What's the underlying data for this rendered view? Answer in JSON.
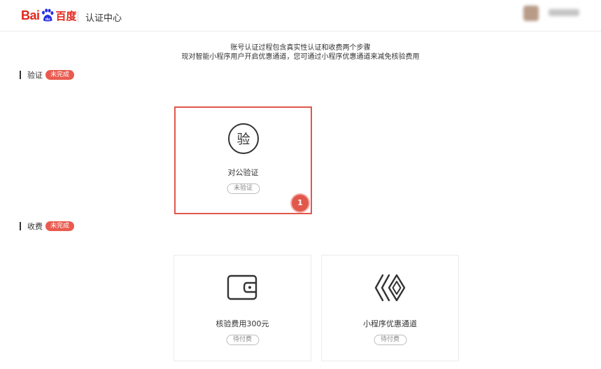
{
  "header": {
    "logo_text": "Bai",
    "logo_cn": "百度",
    "title": "认证中心"
  },
  "notice": {
    "line1": "账号认证过程包含真实性认证和收费两个步骤",
    "line2": "现对智能小程序用户开启优惠通道，您可通过小程序优惠通道来减免核验费用"
  },
  "sections": {
    "verify": {
      "label": "验证",
      "status": "未完成"
    },
    "fee": {
      "label": "收费",
      "status": "未完成"
    }
  },
  "cards": {
    "corporate": {
      "icon_char": "验",
      "title": "对公验证",
      "status": "未验证",
      "step": "1"
    },
    "fee": {
      "title": "核验费用300元",
      "status": "待付费"
    },
    "miniapp": {
      "title": "小程序优惠通道",
      "status": "待付费"
    }
  },
  "colors": {
    "brand": "#e1251b",
    "accent": "#e2574c",
    "badge": "#e95b4f"
  }
}
